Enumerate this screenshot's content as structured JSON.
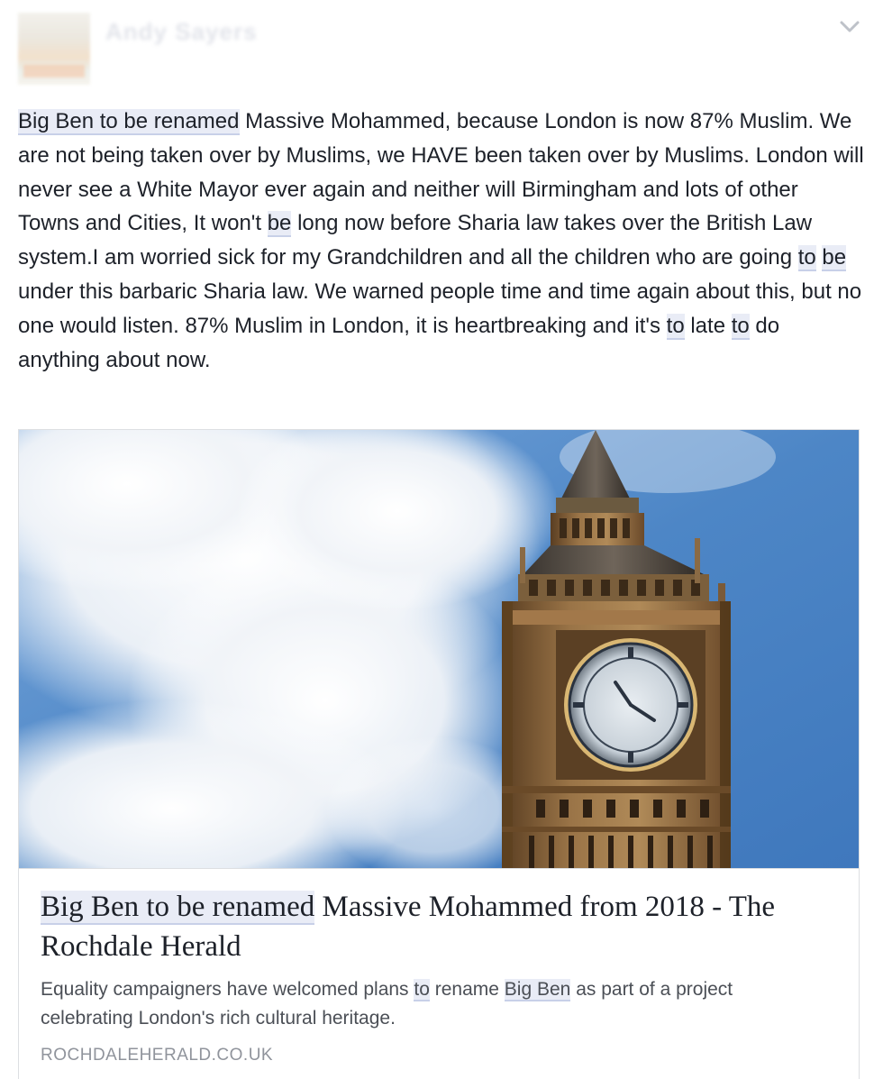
{
  "post": {
    "author_name": "Andy Sayers",
    "menu_icon": "chevron-down-icon",
    "text_segments": [
      {
        "text": "Big Ben to be renamed",
        "highlight": true
      },
      {
        "text": " Massive Mohammed, because London is now 87% Muslim. We are not being taken over by Muslims, we HAVE been taken over by Muslims. London will never see a White Mayor ever again and neither will Birmingham and lots of other Towns and Cities, It won't ",
        "highlight": false
      },
      {
        "text": "be",
        "highlight": true
      },
      {
        "text": " long now before Sharia law takes over the British Law system.I am worried sick for my Grandchildren and all the children who are going ",
        "highlight": false
      },
      {
        "text": "to",
        "highlight": true
      },
      {
        "text": " ",
        "highlight": false
      },
      {
        "text": "be",
        "highlight": true
      },
      {
        "text": " under this barbaric Sharia law. We warned people time and time again about this, but no one would listen. 87% Muslim in London, it is heartbreaking and it's ",
        "highlight": false
      },
      {
        "text": "to",
        "highlight": true
      },
      {
        "text": " late ",
        "highlight": false
      },
      {
        "text": "to",
        "highlight": true
      },
      {
        "text": " do anything about now.",
        "highlight": false
      }
    ]
  },
  "link_card": {
    "title_segments": [
      {
        "text": "Big Ben to be renamed",
        "highlight": true
      },
      {
        "text": " Massive Mohammed from 2018 - The Rochdale Herald",
        "highlight": false
      }
    ],
    "description_segments": [
      {
        "text": "Equality campaigners have welcomed plans ",
        "highlight": false
      },
      {
        "text": "to",
        "highlight": true
      },
      {
        "text": " rename ",
        "highlight": false
      },
      {
        "text": "Big Ben",
        "highlight": true
      },
      {
        "text": " as part of a project celebrating London's rich cultural heritage.",
        "highlight": false
      }
    ],
    "domain": "ROCHDALEHERALD.CO.UK",
    "image_subject": "big-ben-clock-tower-photo"
  },
  "colors": {
    "text": "#1d2129",
    "highlight_bg": "#e9ecf6",
    "highlight_underline": "#c8d0e8",
    "muted": "#90949c",
    "description": "#4b4f56",
    "sky": "#4d86c6"
  }
}
